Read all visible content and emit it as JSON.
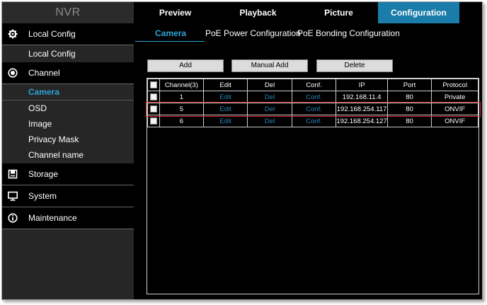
{
  "brand": "NVR",
  "nav_tabs": [
    {
      "label": "Preview"
    },
    {
      "label": "Playback"
    },
    {
      "label": "Picture"
    },
    {
      "label": "Configuration"
    }
  ],
  "sidebar": {
    "local_config": {
      "label": "Local Config",
      "icon": "gear-icon"
    },
    "local_config_sub": "Local Config",
    "channel": {
      "label": "Channel",
      "icon": "camera-icon"
    },
    "channel_items": [
      "Camera",
      "OSD",
      "Image",
      "Privacy Mask",
      "Channel name"
    ],
    "storage": {
      "label": "Storage",
      "icon": "storage-icon"
    },
    "system": {
      "label": "System",
      "icon": "monitor-icon"
    },
    "maintenance": {
      "label": "Maintenance",
      "icon": "info-icon"
    }
  },
  "subtabs": [
    "Camera",
    "PoE Power Configuration",
    "PoE Bonding Configuration"
  ],
  "buttons": {
    "add": "Add",
    "manual_add": "Manual Add",
    "delete": "Delete"
  },
  "table": {
    "headers": [
      "Channel(3)",
      "Edit",
      "Del",
      "Conf.",
      "IP",
      "Port",
      "Protocol"
    ],
    "rows": [
      {
        "channel": "1",
        "edit": "Edit",
        "del": "Del",
        "conf": "Conf.",
        "ip": "192.168.11.4",
        "port": "80",
        "protocol": "Private"
      },
      {
        "channel": "5",
        "edit": "Edit",
        "del": "Del",
        "conf": "Conf.",
        "ip": "192.168.254.117",
        "port": "80",
        "protocol": "ONVIF"
      },
      {
        "channel": "6",
        "edit": "Edit",
        "del": "Del",
        "conf": "Conf.",
        "ip": "192.168.254.127",
        "port": "80",
        "protocol": "ONVIF"
      }
    ]
  },
  "colors": {
    "accent": "#1a7ca8",
    "link": "#2a86b3",
    "highlight": "#d8262a"
  }
}
